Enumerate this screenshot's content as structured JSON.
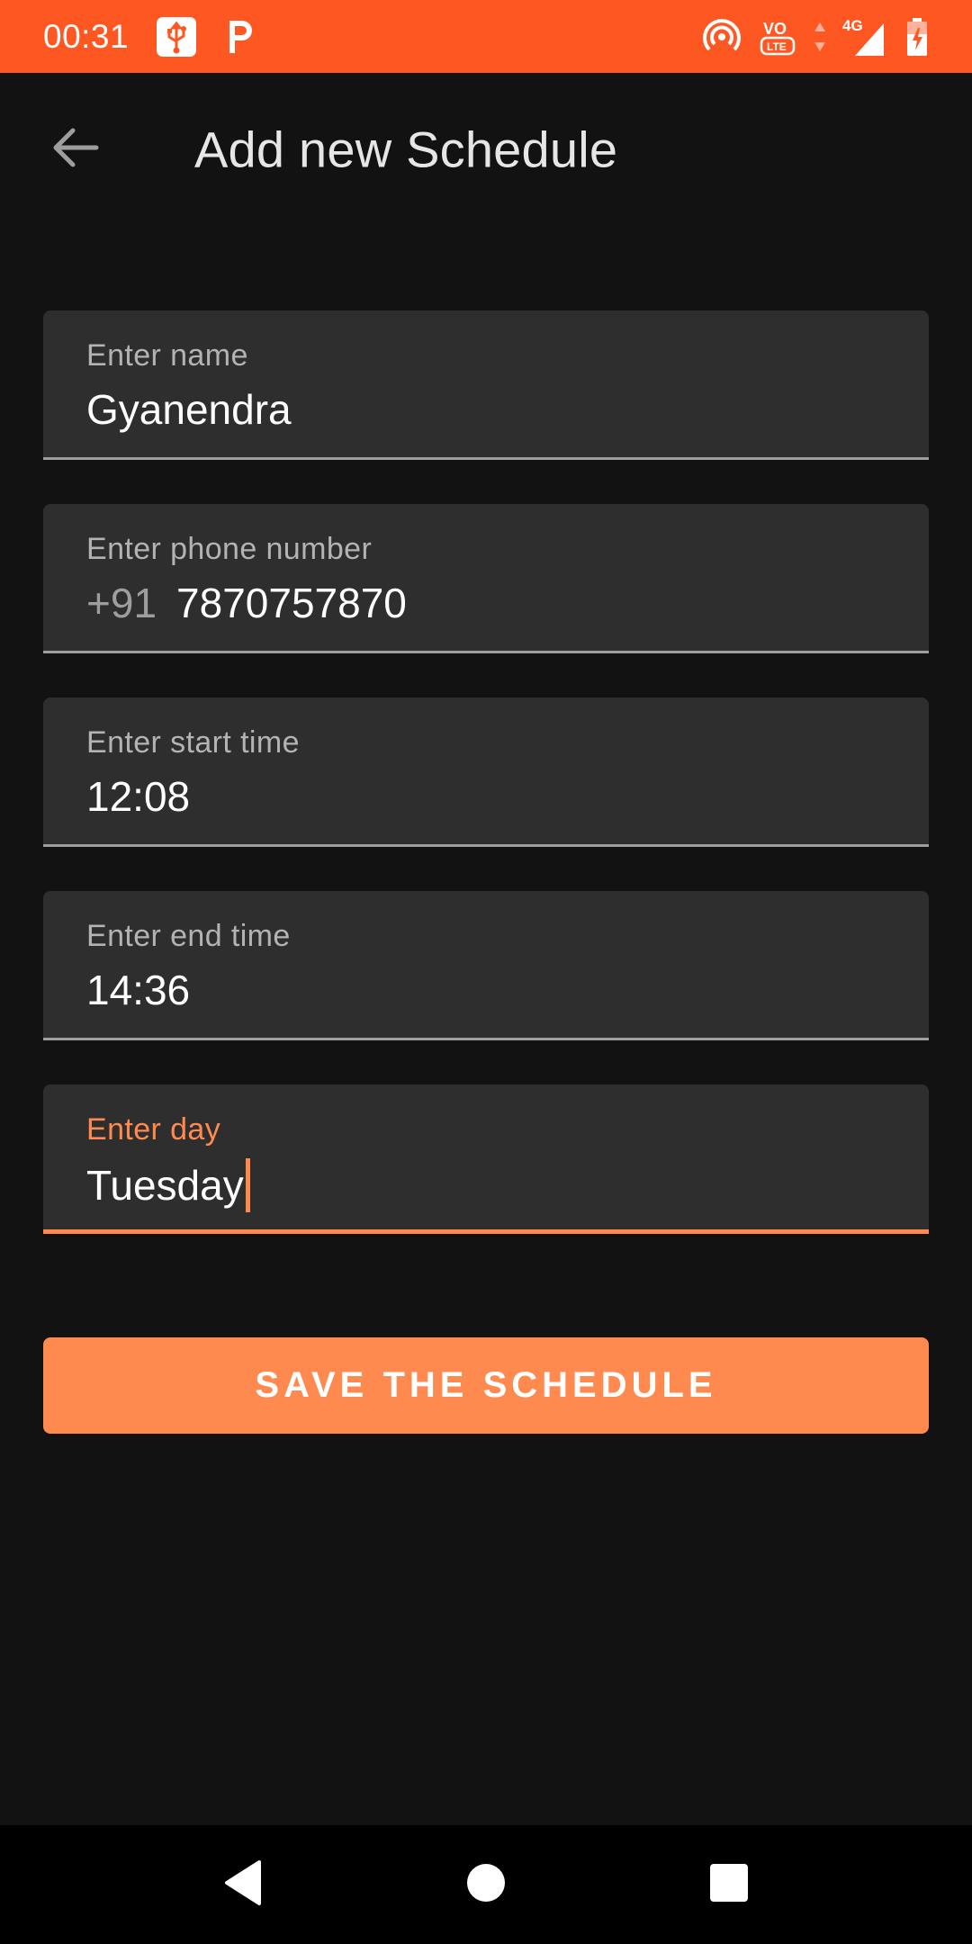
{
  "status_bar": {
    "time": "00:31",
    "network": "4G",
    "icons": [
      "usb-icon",
      "parking-icon",
      "hotspot-icon",
      "volte-icon",
      "signal-icon",
      "battery-charging-icon"
    ],
    "background": "#FF5722"
  },
  "app_bar": {
    "title": "Add new Schedule",
    "back_icon": "arrow-back-icon"
  },
  "form": {
    "name": {
      "label": "Enter name",
      "value": "Gyanendra"
    },
    "phone": {
      "label": "Enter phone number",
      "prefix": "+91",
      "value": "7870757870"
    },
    "start_time": {
      "label": "Enter start time",
      "value": "12:08"
    },
    "end_time": {
      "label": "Enter end time",
      "value": "14:36"
    },
    "day": {
      "label": "Enter day",
      "value": "Tuesday",
      "focused": true
    }
  },
  "save_button": {
    "label": "SAVE THE SCHEDULE"
  },
  "nav_bar": {
    "buttons": [
      "back-triangle-icon",
      "home-circle-icon",
      "recents-square-icon"
    ]
  },
  "colors": {
    "accent": "#FF8A50",
    "background": "#121212",
    "field_background": "#2E2E2E"
  }
}
